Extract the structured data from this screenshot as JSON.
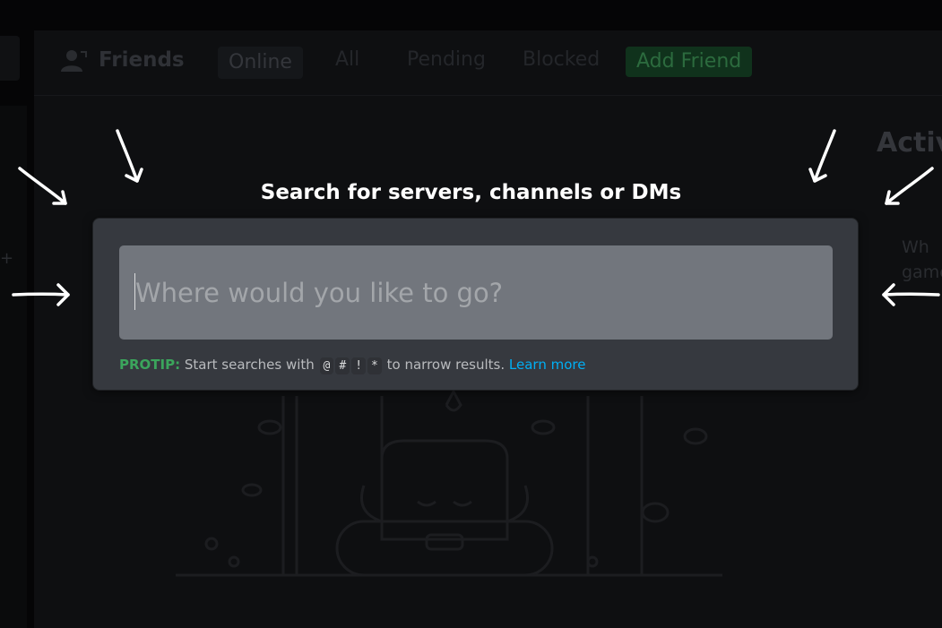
{
  "background": {
    "friends_title": "Friends",
    "tabs": [
      "Online",
      "All",
      "Pending",
      "Blocked",
      "Add Friend"
    ],
    "active_heading": "Activ",
    "active_sub_1": "Wh",
    "active_sub_2": "game"
  },
  "quick_switcher": {
    "heading": "Search for servers, channels or DMs",
    "input_value": "",
    "input_placeholder": "Where would you like to go?",
    "protip_label": "PROTIP:",
    "protip_text_before": "Start searches with",
    "prefixes": [
      "@",
      "#",
      "!",
      "*"
    ],
    "protip_text_after": "to narrow results.",
    "learn_more": "Learn more"
  },
  "colors": {
    "accent_green": "#3ba55c",
    "link_blue": "#00aff4",
    "modal_bg": "#36393f",
    "input_bg": "#72767d"
  }
}
